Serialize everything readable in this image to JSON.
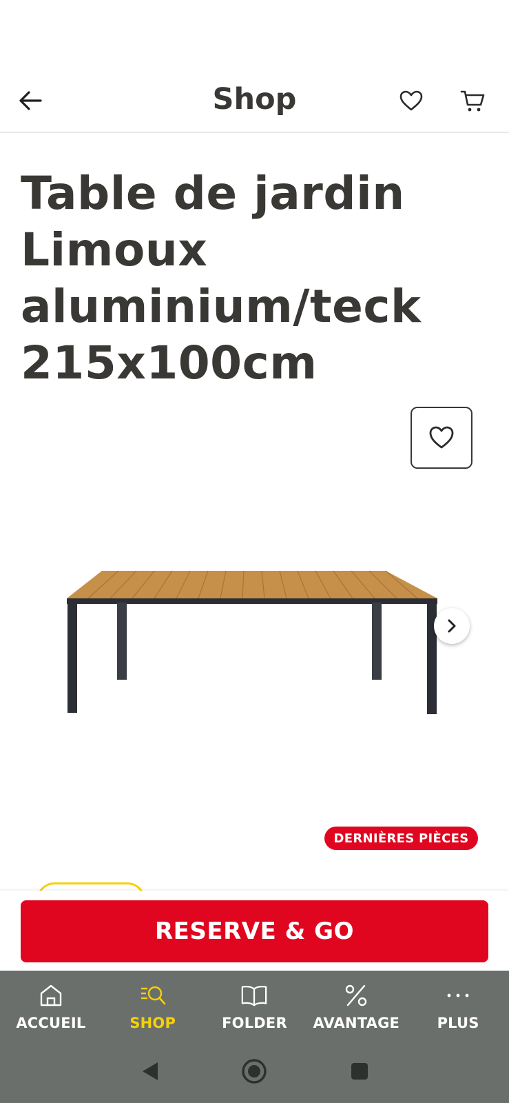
{
  "header": {
    "title": "Shop",
    "back_icon": "arrow-left-icon",
    "wishlist_icon": "heart-icon",
    "cart_icon": "cart-icon"
  },
  "product": {
    "title": "Table de jardin Limoux aluminium/teck 215x100cm",
    "badge": "DERNIÈRES PIÈCES",
    "image_alt": "garden-table-image"
  },
  "cta": {
    "reserve_label": "RESERVE & GO"
  },
  "bottom_nav": {
    "items": [
      {
        "label": "ACCUEIL",
        "icon": "home-icon",
        "active": false
      },
      {
        "label": "SHOP",
        "icon": "shop-search-icon",
        "active": true
      },
      {
        "label": "FOLDER",
        "icon": "book-icon",
        "active": false
      },
      {
        "label": "AVANTAGE",
        "icon": "percent-icon",
        "active": false
      },
      {
        "label": "PLUS",
        "icon": "more-dots-icon",
        "active": false
      }
    ]
  },
  "colors": {
    "brand_red": "#e0061f",
    "accent_yellow": "#f5d10a",
    "nav_bg": "#6b6f6c",
    "text_dark": "#3a3834"
  }
}
